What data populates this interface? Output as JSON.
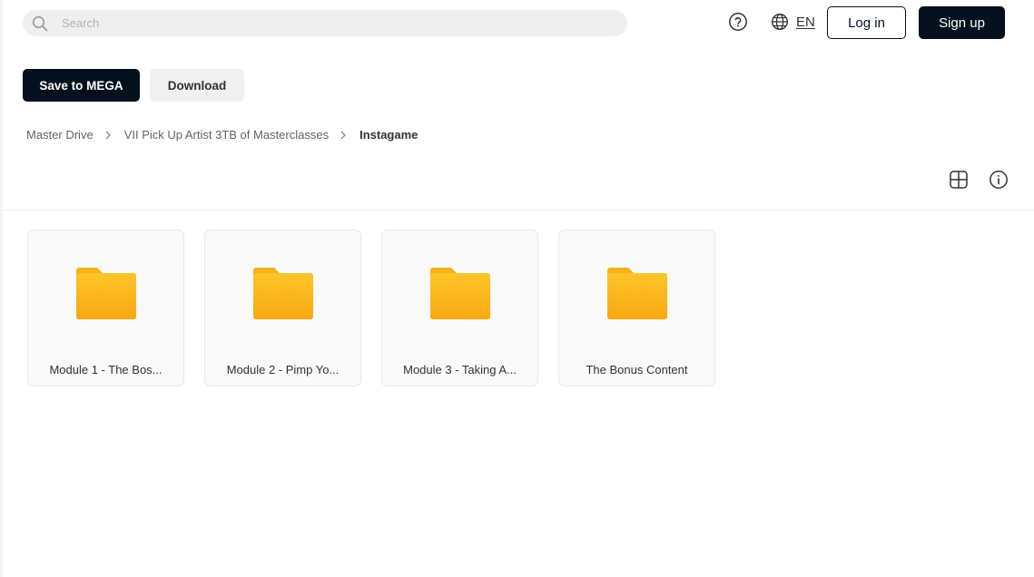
{
  "search": {
    "placeholder": "Search"
  },
  "header": {
    "language": "EN",
    "login_label": "Log in",
    "signup_label": "Sign up"
  },
  "actions": {
    "save_label": "Save to MEGA",
    "download_label": "Download"
  },
  "breadcrumb": [
    {
      "label": "Master Drive"
    },
    {
      "label": "VII Pick Up Artist 3TB of Masterclasses"
    },
    {
      "label": "Instagame"
    }
  ],
  "folders": [
    {
      "name": "Module 1 - The Bos..."
    },
    {
      "name": "Module 2 - Pimp Yo..."
    },
    {
      "name": "Module 3 - Taking A..."
    },
    {
      "name": "The Bonus Content"
    }
  ],
  "colors": {
    "primary_dark": "#04101e",
    "folder_yellow_top": "#fdc52b",
    "folder_yellow_bottom": "#f9a711"
  },
  "icons": {
    "search": "search-icon",
    "help": "help-icon",
    "language": "globe-icon",
    "chevron": "chevron-right-icon",
    "view": "grid-view-icon",
    "info": "info-icon",
    "folder": "folder-icon"
  }
}
